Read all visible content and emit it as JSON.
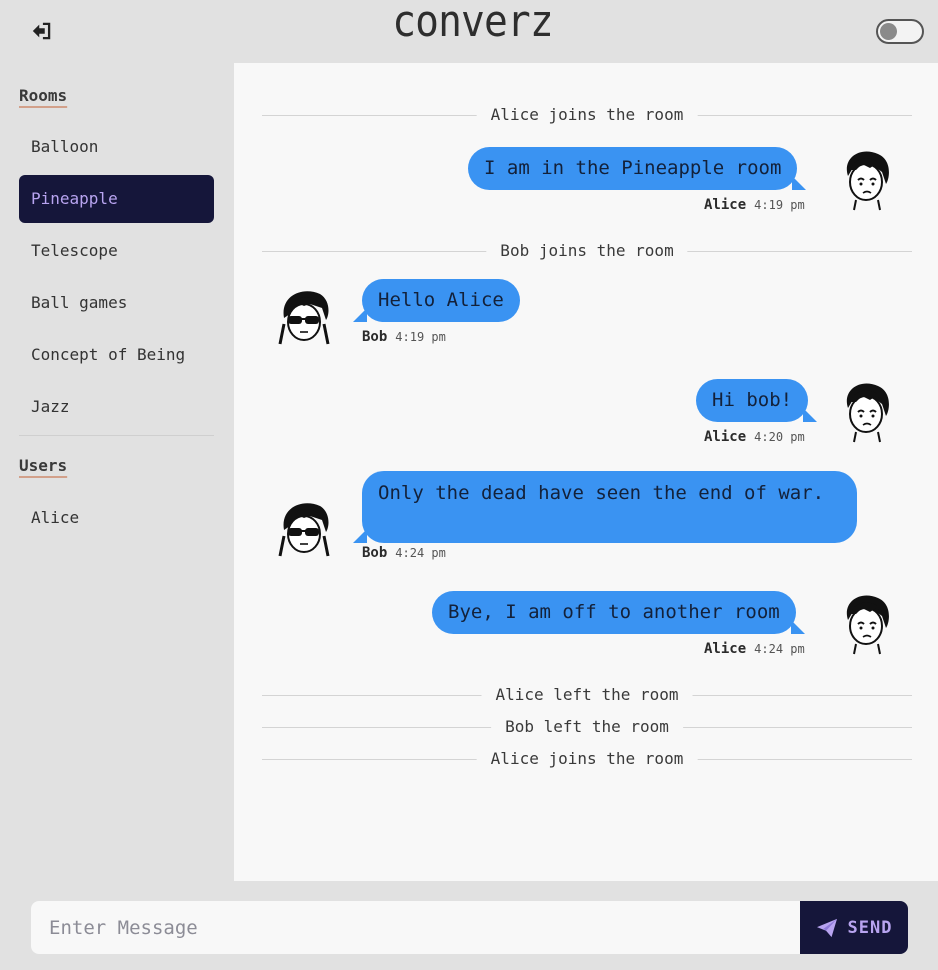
{
  "header": {
    "title": "converz",
    "logout_icon": "logout-icon",
    "theme_toggle": "off"
  },
  "sidebar": {
    "rooms_title": "Rooms",
    "rooms": [
      {
        "label": "Balloon"
      },
      {
        "label": "Pineapple",
        "active": true
      },
      {
        "label": "Telescope"
      },
      {
        "label": "Ball games"
      },
      {
        "label": "Concept of Being"
      },
      {
        "label": "Jazz"
      }
    ],
    "users_title": "Users",
    "users": [
      {
        "label": "Alice"
      }
    ]
  },
  "chat": {
    "events": [
      {
        "type": "system",
        "text": "Alice joins the room"
      },
      {
        "type": "message",
        "side": "right",
        "author": "Alice",
        "time": "4:19 pm",
        "text": "I am in the Pineapple room"
      },
      {
        "type": "system",
        "text": "Bob joins the room"
      },
      {
        "type": "message",
        "side": "left",
        "author": "Bob",
        "time": "4:19 pm",
        "text": "Hello Alice"
      },
      {
        "type": "message",
        "side": "right",
        "author": "Alice",
        "time": "4:20 pm",
        "text": "Hi bob!"
      },
      {
        "type": "message",
        "side": "left",
        "author": "Bob",
        "time": "4:24 pm",
        "text": "Only the dead have seen the end of war."
      },
      {
        "type": "message",
        "side": "right",
        "author": "Alice",
        "time": "4:24 pm",
        "text": "Bye, I am off to another room"
      },
      {
        "type": "system",
        "text": "Alice left the room"
      },
      {
        "type": "system",
        "text": "Bob left the room"
      },
      {
        "type": "system",
        "text": "Alice joins the room"
      }
    ]
  },
  "composer": {
    "placeholder": "Enter Message",
    "value": "",
    "send_label": "SEND",
    "send_icon": "paper-plane-icon"
  },
  "colors": {
    "accent": "#15163a",
    "accent_text": "#b8a4f0",
    "bubble": "#3a93f2",
    "background": "#e1e1e1",
    "panel": "#f8f8f8"
  }
}
